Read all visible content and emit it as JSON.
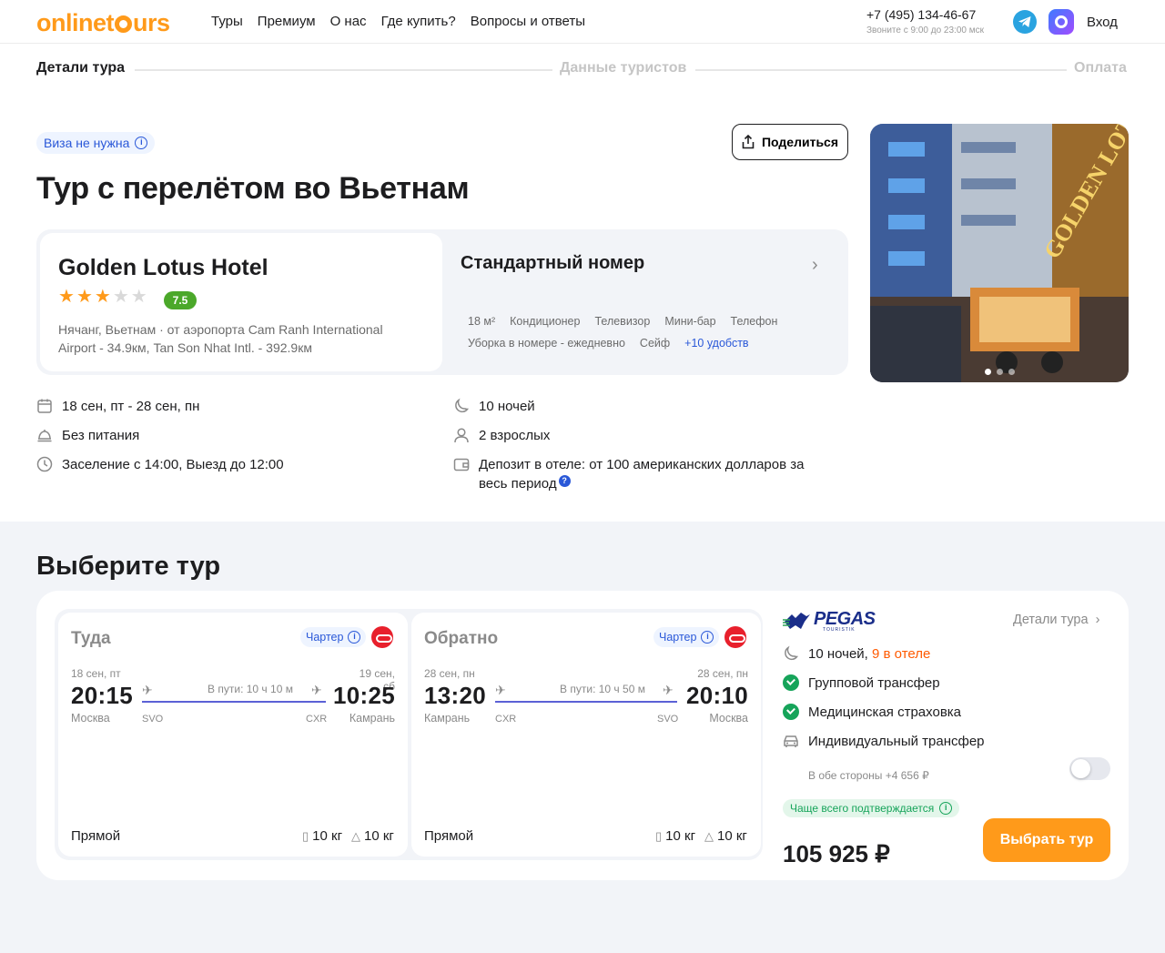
{
  "header": {
    "logo": {
      "left": "onlinet",
      "right": "urs"
    },
    "nav": [
      "Туры",
      "Премиум",
      "О нас",
      "Где купить?",
      "Вопросы и ответы"
    ],
    "phone": "+7 (495) 134-46-67",
    "phone_hours": "Звоните с 9:00 до 23:00 мск",
    "login": "Вход"
  },
  "stepper": {
    "steps": [
      {
        "label": "Детали тура",
        "state": "active"
      },
      {
        "label": "Данные туристов",
        "state": "inactive"
      },
      {
        "label": "Оплата",
        "state": "inactive"
      }
    ]
  },
  "tour": {
    "visa_badge": "Виза не нужна",
    "share_label": "Поделиться",
    "title": "Тур с перелётом во Вьетнам"
  },
  "hotel": {
    "name": "Golden Lotus Hotel",
    "stars": 3,
    "stars_max": 5,
    "rating": "7.5",
    "location": "Нячанг, Вьетнам · от аэропорта Cam Ranh International Airport - 34.9км, Tan Son Nhat Intl. - 392.9км",
    "photo_count": 3,
    "photo_active": 1,
    "photo_sign": "GOLDEN LOTUS"
  },
  "room": {
    "title": "Стандартный номер",
    "amenities": [
      "18 м²",
      "Кондиционер",
      "Телевизор",
      "Мини-бар",
      "Телефон",
      "Уборка в номере - ежедневно",
      "Сейф"
    ],
    "more": "+10 удобств"
  },
  "facts": {
    "dates": "18 сен, пт - 28 сен, пн",
    "meal": "Без питания",
    "checkin": "Заселение с 14:00, Выезд до 12:00",
    "nights": "10 ночей",
    "guests": "2 взрослых",
    "deposit": "Депозит в отеле: от 100 американских долларов за весь период"
  },
  "tours_section": {
    "title": "Выберите тур",
    "outbound": {
      "label": "Туда",
      "charter": "Чартер",
      "dep_date": "18 сен, пт",
      "dep_time": "20:15",
      "dep_city": "Москва",
      "dep_code": "SVO",
      "duration": "В пути: 10 ч 10 м",
      "arr_date": "19 сен, сб",
      "arr_time": "10:25",
      "arr_city": "Камрань",
      "arr_code": "CXR",
      "type": "Прямой",
      "baggage": "10 кг",
      "hand": "10 кг"
    },
    "return": {
      "label": "Обратно",
      "charter": "Чартер",
      "dep_date": "28 сен, пн",
      "dep_time": "13:20",
      "dep_city": "Камрань",
      "dep_code": "CXR",
      "duration": "В пути: 10 ч 50 м",
      "arr_date": "28 сен, пн",
      "arr_time": "20:10",
      "arr_city": "Москва",
      "arr_code": "SVO",
      "type": "Прямой",
      "baggage": "10 кг",
      "hand": "10 кг"
    },
    "summary": {
      "operator": "PEGAS",
      "operator_sub": "TOURISTIK",
      "details_link": "Детали тура",
      "nights": "10 ночей,",
      "nights_hotel": "9 в отеле",
      "group_transfer": "Групповой трансфер",
      "insurance": "Медицинская страховка",
      "individual_transfer": "Индивидуальный трансфер",
      "individual_transfer_sub": "В обе стороны +4 656 ₽",
      "individual_transfer_on": false,
      "confirm_badge": "Чаще всего подтверждается",
      "price": "105 925 ₽",
      "choose_label": "Выбрать тур"
    }
  },
  "colors": {
    "brand": "#ff9a1a",
    "accent_blue": "#2a58d8",
    "rating_green": "#4ba82a",
    "success_green": "#16a45a",
    "flight_line": "#5b61d6",
    "hotel_orange": "#ff5a00"
  },
  "icons": [
    "telegram-icon",
    "max-messenger-icon",
    "info-icon",
    "share-icon",
    "chevron-right-icon",
    "calendar-icon",
    "meal-icon",
    "clock-icon",
    "moon-icon",
    "person-icon",
    "wallet-icon",
    "takeoff-icon",
    "landing-icon",
    "suitcase-icon",
    "handbag-icon",
    "check-icon",
    "car-icon"
  ]
}
